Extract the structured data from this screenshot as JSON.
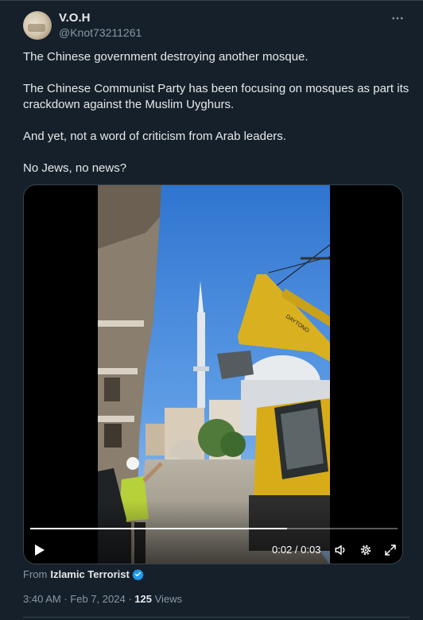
{
  "author": {
    "display_name": "V.O.H",
    "handle": "@Knot73211261",
    "avatar_icon": "avatar-image"
  },
  "more_icon": "more-horizontal-icon",
  "tweet": {
    "paragraphs": [
      "The Chinese government destroying another mosque.",
      "The Chinese Communist Party has been focusing on mosques as part its crackdown against the Muslim Uyghurs.",
      "And yet, not a word of criticism from Arab leaders.",
      "No Jews, no news?"
    ]
  },
  "video": {
    "time_display": "0:02 / 0:03",
    "progress": 0.7,
    "excavator_text": "DAYTONO",
    "icons": {
      "play": "play-icon",
      "volume": "volume-icon",
      "settings": "gear-icon",
      "fullscreen": "fullscreen-icon"
    }
  },
  "source": {
    "prefix": "From",
    "name": "Izlamic Terrorist",
    "verified_icon": "verified-badge-icon",
    "verified_color": "#1d9bf0"
  },
  "meta": {
    "time": "3:40 AM",
    "separator": "·",
    "date": "Feb 7, 2024",
    "views_count": "125",
    "views_label": "Views"
  },
  "colors": {
    "background": "#15202b",
    "text_primary": "#e7e9ea",
    "text_secondary": "#8b98a5",
    "border": "#38444d",
    "accent": "#1d9bf0"
  }
}
